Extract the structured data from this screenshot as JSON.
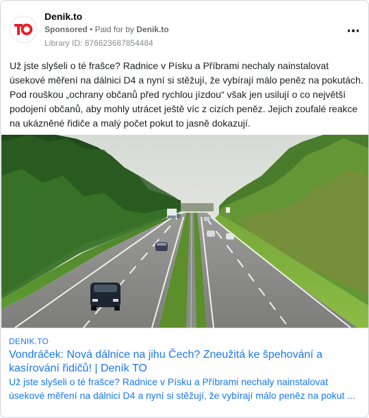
{
  "ad": {
    "page_name": "Denik.to",
    "sponsored_label": "Sponsored",
    "separator": "•",
    "paid_for_prefix": "Paid for by",
    "paid_for_name": "Denik.to",
    "library_id": "Library ID: 876623687854484",
    "avatar_icon": "denik-to-logo",
    "brand_color": "#e4222a"
  },
  "post": {
    "text": "Už jste slyšeli o té frašce? Radnice v Písku a Příbrami nechaly nainstalovat úsekové měření na dálnici D4 a nyní si stěžují, že vybírají málo peněz na pokutách. Pod rouškou „ochrany občanů před rychlou jízdou“ však jen usilují o co největší podojení občanů, aby mohly utrácet ještě víc z cizích peněz. Jejich zoufalé reakce na ukázněné řidiče a malý počet pokut to jasně dokazují."
  },
  "link": {
    "domain": "DENIK.TO",
    "title": "Vondráček: Nová dálnice na jihu Čech? Zneužitá ke špehování a kasírování řidičů! | Deník TO",
    "description": "Už jste slyšeli o té frašce? Radnice v Písku a Příbrami nechaly nainstalovat úsekové měření na dálnici D4 a nyní si stěžují, že vybírají málo peněz na pokut ...",
    "link_color": "#1877f2"
  },
  "icons": {
    "more": "more-options-icon"
  }
}
